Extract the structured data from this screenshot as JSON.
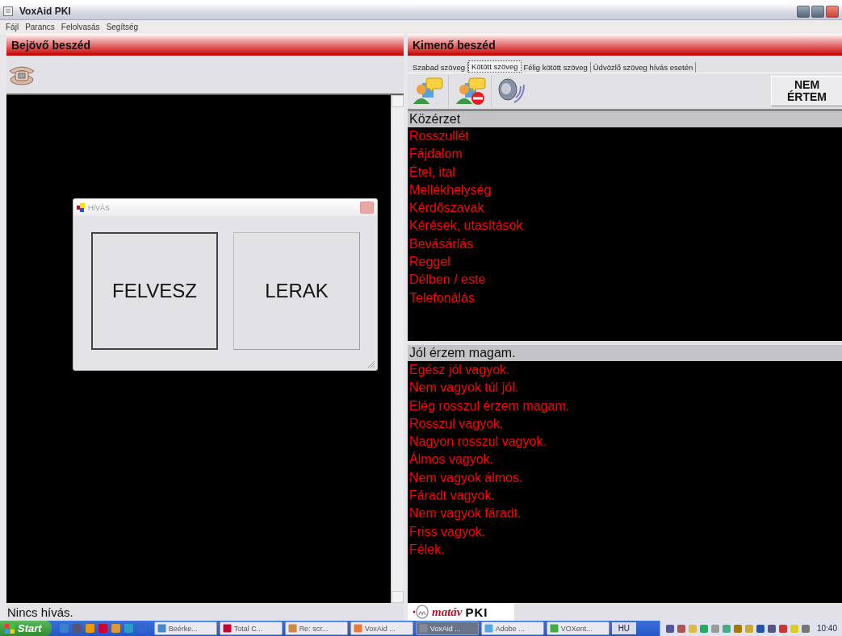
{
  "window": {
    "title": "VoxAid PKI"
  },
  "menu": [
    {
      "label": "Fájl"
    },
    {
      "label": "Parancs"
    },
    {
      "label": "Felolvasás"
    },
    {
      "label": "Segítség"
    }
  ],
  "incoming": {
    "title": "Bejövő beszéd",
    "status": "Nincs hívás."
  },
  "dialog": {
    "title": "HÍVÁS",
    "buttons": [
      {
        "label": "FELVESZ",
        "focused": true
      },
      {
        "label": "LERAK",
        "focused": false
      }
    ]
  },
  "outgoing": {
    "title": "Kimenő beszéd",
    "tabs": [
      {
        "label": "Szabad szöveg",
        "selected": false
      },
      {
        "label": "Kötött szöveg",
        "selected": true
      },
      {
        "label": "Félig kötött szöveg",
        "selected": false
      },
      {
        "label": "Üdvözlő szöveg hívás esetén",
        "selected": false
      }
    ],
    "nem_ertem_button": "NEM ÉRTEM",
    "categories": {
      "header": "Közérzet",
      "items": [
        "Rosszullét",
        "Fájdalom",
        "Étel, ital",
        "Mellékhelység",
        "Kérdőszavak",
        "Kérések, utasítások",
        "Bevásárlás",
        "Reggel",
        "Délben / este",
        "Telefonálás"
      ]
    },
    "phrases": {
      "header": "Jól érzem magam.",
      "items": [
        "Egész jól vagyok.",
        "Nem vagyok túl jól.",
        "Elég rosszul érzem magam.",
        "Rosszul vagyok.",
        "Nagyon rosszul vagyok.",
        "Álmos vagyok.",
        "Nem vagyok álmos.",
        "Fáradt vagyok.",
        "Nem vagyok fáradt.",
        "Friss vagyok.",
        "Félek."
      ]
    },
    "logo": {
      "brand": "matáv",
      "text": "PKI"
    }
  },
  "taskbar": {
    "start": "Start",
    "tasks": [
      {
        "label": "Beérke...",
        "selected": false
      },
      {
        "label": "Total C...",
        "selected": false
      },
      {
        "label": "Re: scr...",
        "selected": false
      },
      {
        "label": "VoxAid ...",
        "selected": false
      },
      {
        "label": "VoxAid ...",
        "selected": true
      },
      {
        "label": "Adobe ...",
        "selected": false
      },
      {
        "label": "VOXent...",
        "selected": false
      }
    ],
    "language": "HU",
    "clock": "10:40"
  }
}
